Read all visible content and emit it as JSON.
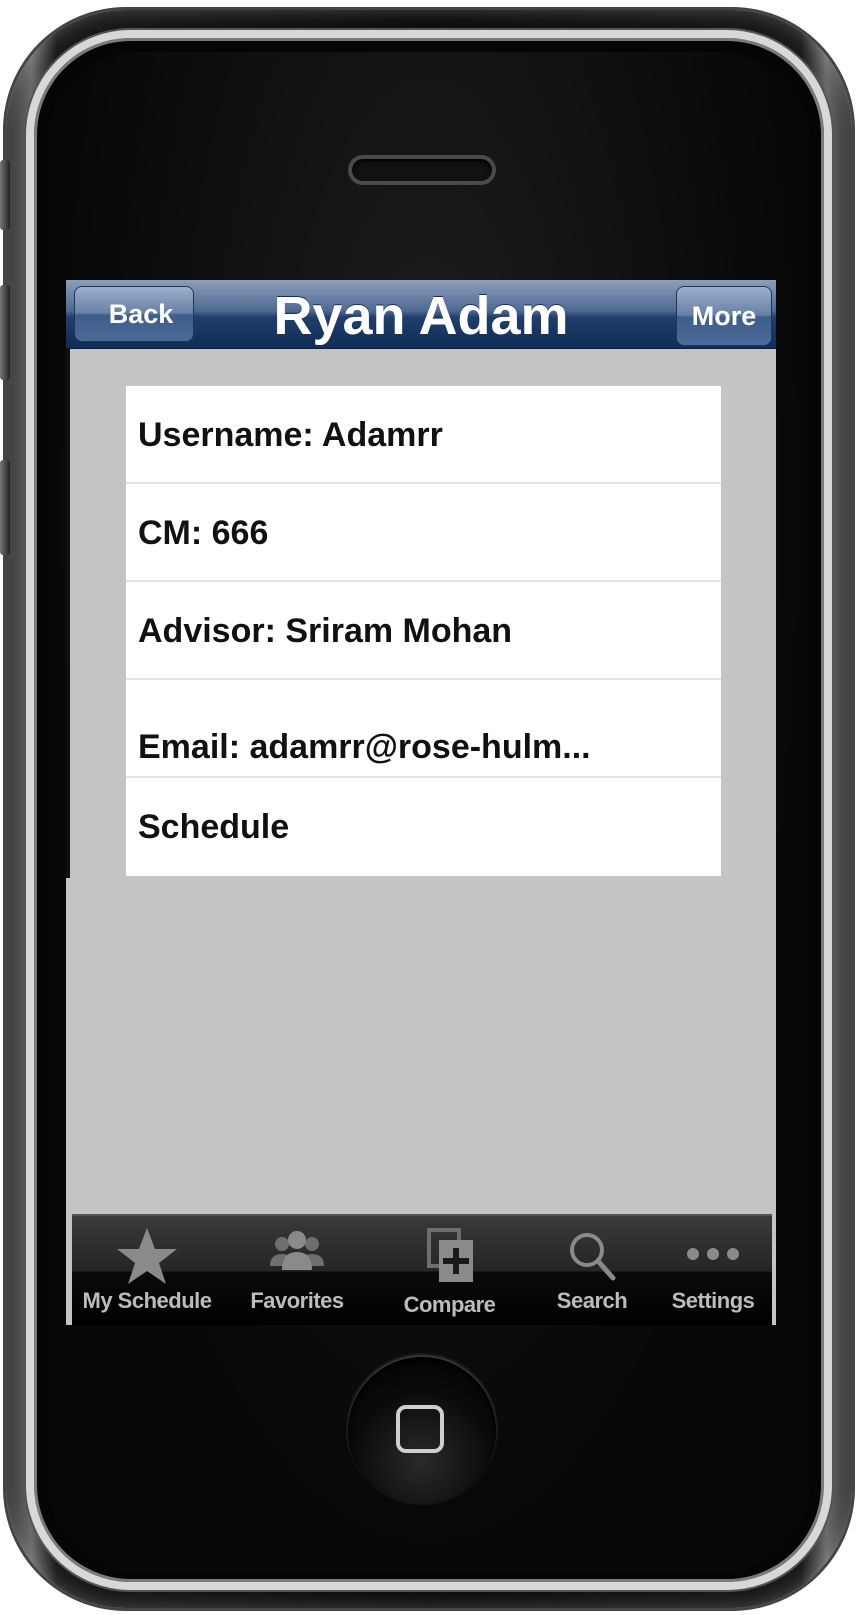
{
  "nav": {
    "title": "Ryan Adam",
    "back_label": "Back",
    "more_label": "More"
  },
  "details": [
    {
      "text": "Username: Adamrr"
    },
    {
      "text": "CM: 666"
    },
    {
      "text": "Advisor: Sriram Mohan"
    },
    {
      "text": "Email: adamrr@rose-hulm..."
    },
    {
      "text": "Schedule"
    }
  ],
  "tabs": [
    {
      "label": "My Schedule",
      "icon": "star-icon"
    },
    {
      "label": "Favorites",
      "icon": "people-icon"
    },
    {
      "label": "Compare",
      "icon": "compare-icon"
    },
    {
      "label": "Search",
      "icon": "search-icon"
    },
    {
      "label": "Settings",
      "icon": "more-dots-icon"
    }
  ],
  "colors": {
    "nav_bar": "#203e6c",
    "screen_background": "#c4c4c4",
    "tab_bar": "#1a1a1a",
    "tab_icon": "#8a8a8a"
  }
}
